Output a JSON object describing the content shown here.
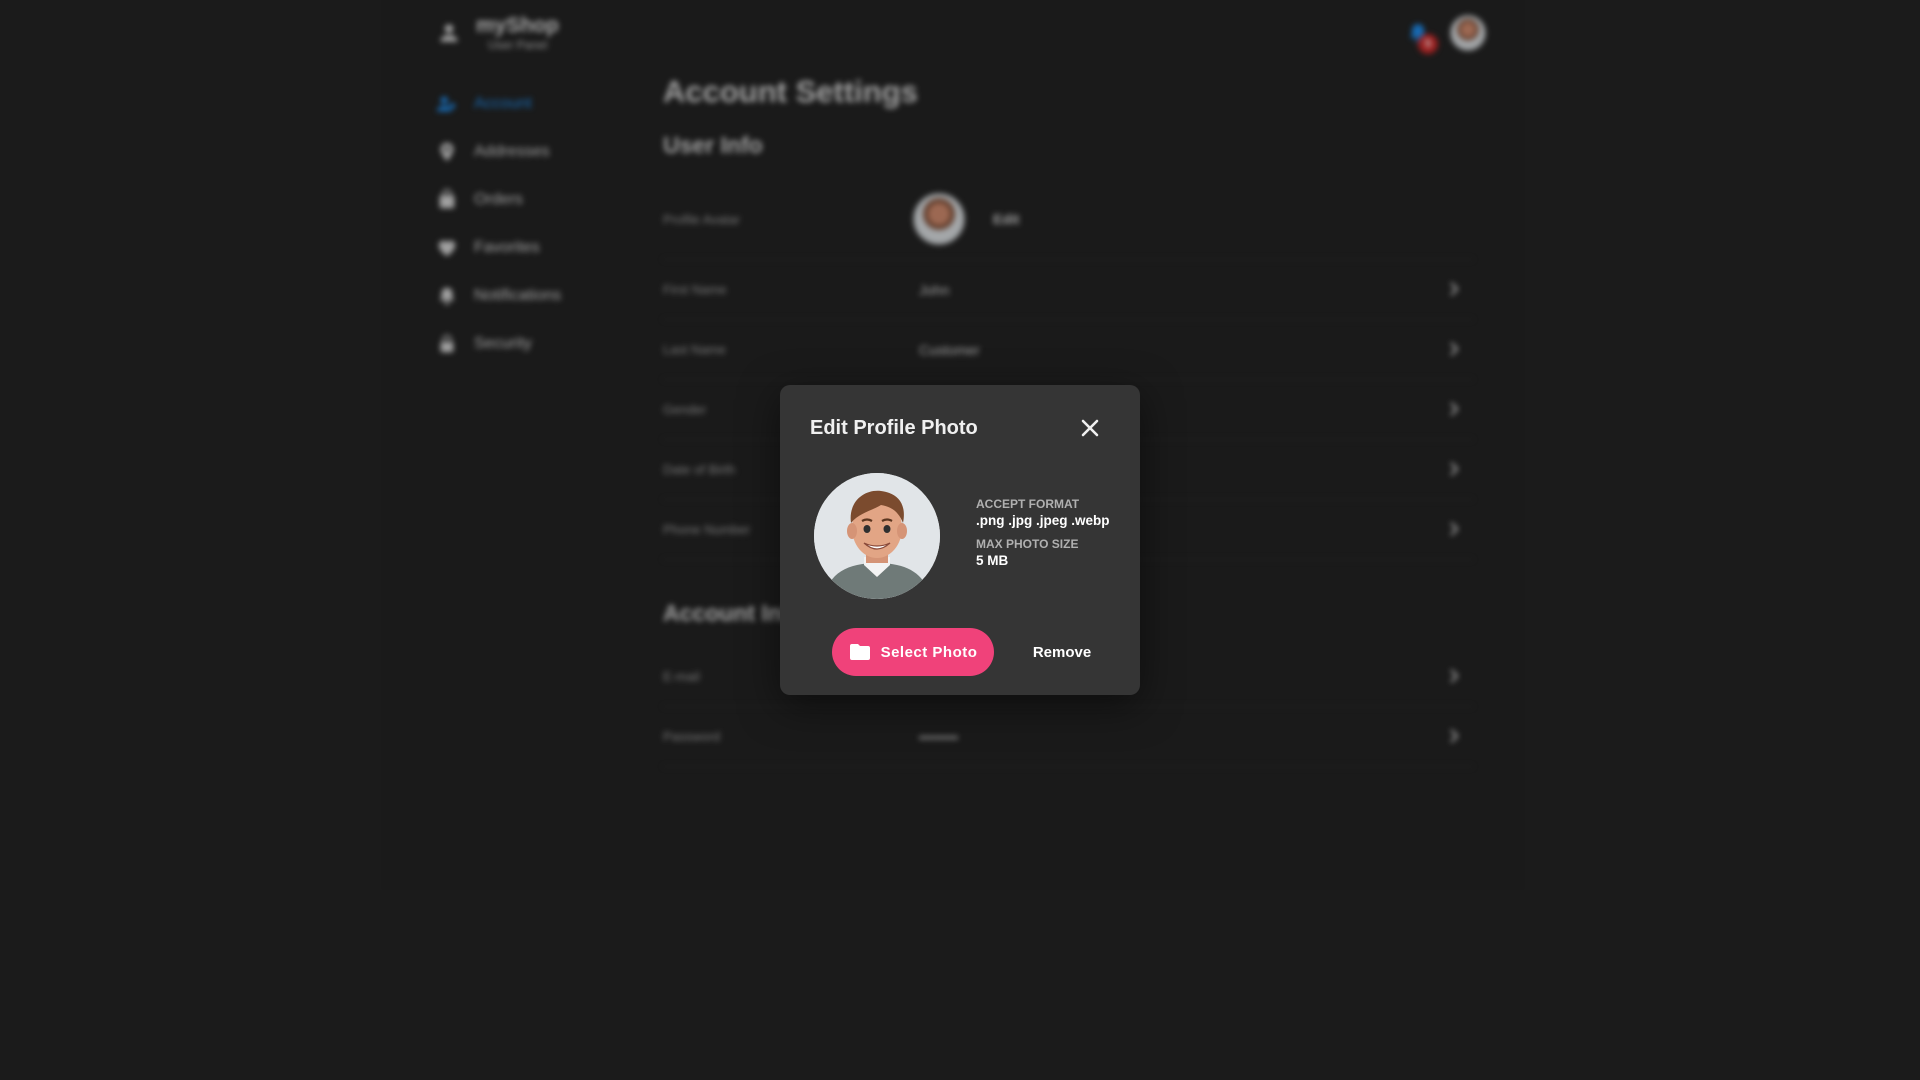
{
  "brand": {
    "name": "myShop",
    "subtitle": "User Panel"
  },
  "header": {
    "notification_count": "5"
  },
  "sidebar": {
    "items": [
      {
        "label": "Account",
        "icon": "account-icon",
        "active": true
      },
      {
        "label": "Addresses",
        "icon": "location-pin-icon"
      },
      {
        "label": "Orders",
        "icon": "shopping-bag-icon"
      },
      {
        "label": "Favorites",
        "icon": "heart-icon"
      },
      {
        "label": "Notifications",
        "icon": "bell-icon"
      },
      {
        "label": "Security",
        "icon": "lock-icon"
      }
    ]
  },
  "main": {
    "title": "Account Settings",
    "user_info": {
      "title": "User Info",
      "avatar_label": "Profile Avatar",
      "edit_label": "Edit",
      "rows": [
        {
          "label": "First Name",
          "value": "John"
        },
        {
          "label": "Last Name",
          "value": "Customer"
        },
        {
          "label": "Gender",
          "value": ""
        },
        {
          "label": "Date of Birth",
          "value": ""
        },
        {
          "label": "Phone Number",
          "value": ""
        }
      ]
    },
    "account_info": {
      "title": "Account Info",
      "rows": [
        {
          "label": "E-mail",
          "value": ""
        },
        {
          "label": "Password",
          "value": "••••••••"
        }
      ]
    }
  },
  "modal": {
    "title": "Edit Profile Photo",
    "accept_format_label": "ACCEPT FORMAT",
    "accept_format_value": ".png .jpg .jpeg .webp",
    "max_size_label": "MAX PHOTO SIZE",
    "max_size_value": "5 MB",
    "select_label": "Select Photo",
    "remove_label": "Remove"
  },
  "colors": {
    "accent": "#f0427a",
    "active_nav": "#1e88e5",
    "badge": "#c62828",
    "background": "#222222",
    "modal": "#353535"
  }
}
